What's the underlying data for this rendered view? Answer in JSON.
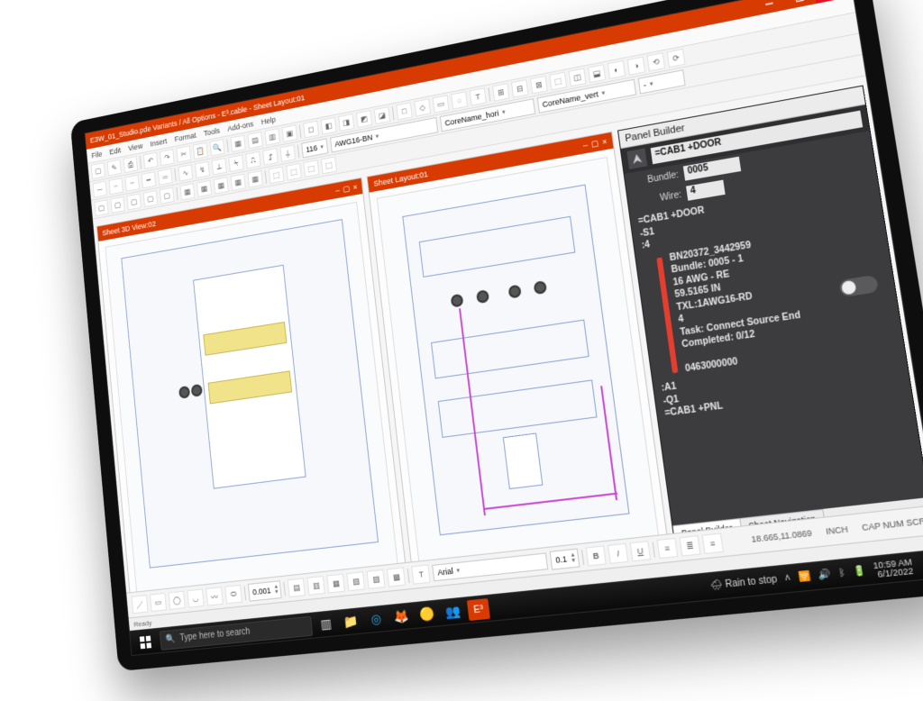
{
  "app": {
    "title": "E3W_01_Studio.pde Variants / All Options - E³.cable - Sheet Layout:01",
    "menu": [
      "File",
      "Edit",
      "View",
      "Insert",
      "Format",
      "Tools",
      "Add-ons",
      "Help"
    ],
    "ribbon_combos": {
      "layer": "116",
      "wirestyle": "AWG16-BN",
      "core1": "CoreName_hori",
      "core2": "CoreName_vert",
      "extra": "-"
    }
  },
  "subwindows": {
    "left_title": "Sheet 3D View:02",
    "right_title": "Sheet Layout:01"
  },
  "panelbuilder": {
    "header": "Panel Builder",
    "location": "=CAB1 +DOOR",
    "bundle_label": "Bundle:",
    "bundle_value": "0005",
    "wire_label": "Wire:",
    "wire_value": "4",
    "tree": {
      "loc": "=CAB1 +DOOR",
      "dev": "-S1",
      "pin": ":4",
      "wire_bar": {
        "part": "BN20372_3442959",
        "bundle": "Bundle: 0005 - 1",
        "gauge": "16 AWG - RE",
        "length": "59.5165 IN",
        "txt": "TXL:1AWG16-RD",
        "qty": "4",
        "task": "Task: Connect Source End",
        "completed": "Completed: 0/12",
        "code": "0463000000"
      },
      "target_pin": ":A1",
      "target_dev": "-Q1",
      "target_loc": "=CAB1 +PNL"
    },
    "tabs": {
      "active": "Panel Builder",
      "other": "Sheet Navigation"
    }
  },
  "fmtbar": {
    "font": "Arial",
    "size": "0.1",
    "nudge": "0.001",
    "coord": "18.665,11.0869",
    "units": "INCH",
    "locks": "CAP  NUM  SCRL"
  },
  "appstatus": {
    "text": "Ready"
  },
  "taskbar": {
    "search_placeholder": "Type here to search",
    "weather": "Rain to stop",
    "time": "10:59 AM",
    "date": "6/1/2022"
  }
}
